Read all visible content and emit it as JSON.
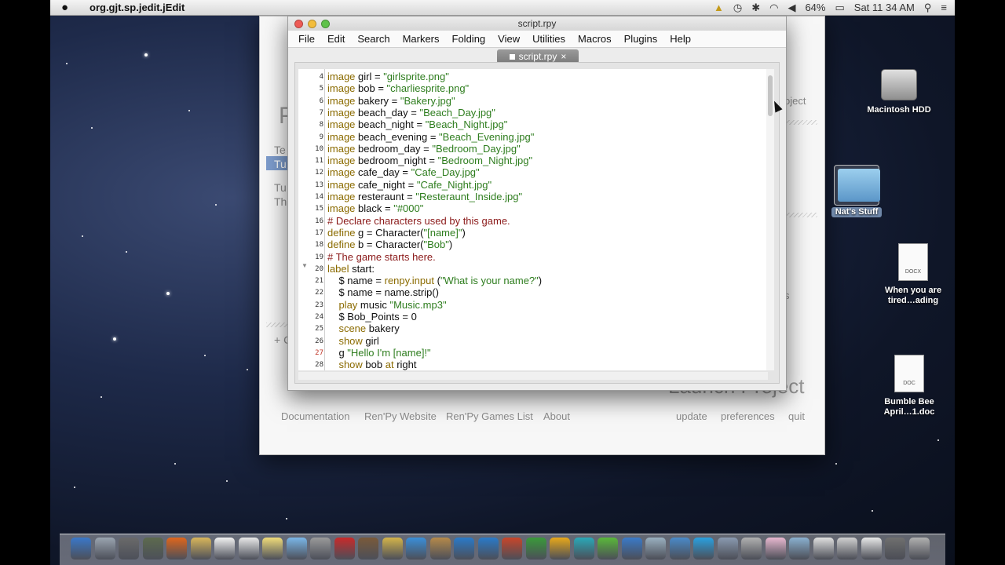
{
  "menubar": {
    "app_name": "org.gjt.sp.jedit.jEdit",
    "battery": "64%",
    "clock": "Sat 11 34 AM"
  },
  "launcher": {
    "partial_labels": [
      "Te",
      "Tu",
      "Tu",
      "Th"
    ],
    "project_partial": "oject",
    "plus_partial": "+ C",
    "launch_project": "Launch Project",
    "links": [
      "Documentation",
      "Ren'Py Website",
      "Ren'Py Games List",
      "About"
    ],
    "right_links": [
      "update",
      "preferences",
      "quit"
    ]
  },
  "editor": {
    "window_title": "script.rpy",
    "menus": [
      "File",
      "Edit",
      "Search",
      "Markers",
      "Folding",
      "View",
      "Utilities",
      "Macros",
      "Plugins",
      "Help"
    ],
    "tab_label": "script.rpy",
    "tab_close": "×",
    "lines": [
      {
        "n": "4",
        "t": [
          [
            "kw",
            "image"
          ],
          [
            "",
            "girl = "
          ],
          [
            "str",
            "\"girlsprite.png\""
          ]
        ]
      },
      {
        "n": "5",
        "t": [
          [
            "kw",
            "image"
          ],
          [
            "",
            "bob = "
          ],
          [
            "str",
            "\"charliesprite.png\""
          ]
        ]
      },
      {
        "n": "6",
        "t": [
          [
            "kw",
            "image"
          ],
          [
            "",
            "bakery = "
          ],
          [
            "str",
            "\"Bakery.jpg\""
          ]
        ]
      },
      {
        "n": "7",
        "t": [
          [
            "kw",
            "image"
          ],
          [
            "",
            "beach_day = "
          ],
          [
            "str",
            "\"Beach_Day.jpg\""
          ]
        ]
      },
      {
        "n": "8",
        "t": [
          [
            "kw",
            "image"
          ],
          [
            "",
            "beach_night = "
          ],
          [
            "str",
            "\"Beach_Night.jpg\""
          ]
        ]
      },
      {
        "n": "9",
        "t": [
          [
            "kw",
            "image"
          ],
          [
            "",
            "beach_evening = "
          ],
          [
            "str",
            "\"Beach_Evening.jpg\""
          ]
        ]
      },
      {
        "n": "10",
        "t": [
          [
            "kw",
            "image"
          ],
          [
            "",
            "bedroom_day = "
          ],
          [
            "str",
            "\"Bedroom_Day.jpg\""
          ]
        ]
      },
      {
        "n": "11",
        "t": [
          [
            "kw",
            "image"
          ],
          [
            "",
            "bedroom_night = "
          ],
          [
            "str",
            "\"Bedroom_Night.jpg\""
          ]
        ]
      },
      {
        "n": "12",
        "t": [
          [
            "kw",
            "image"
          ],
          [
            "",
            "cafe_day = "
          ],
          [
            "str",
            "\"Cafe_Day.jpg\""
          ]
        ]
      },
      {
        "n": "13",
        "t": [
          [
            "kw",
            "image"
          ],
          [
            "",
            "cafe_night = "
          ],
          [
            "str",
            "\"Cafe_Night.jpg\""
          ]
        ]
      },
      {
        "n": "14",
        "t": [
          [
            "kw",
            "image"
          ],
          [
            "",
            "resteraunt = "
          ],
          [
            "str",
            "\"Resteraunt_Inside.jpg\""
          ]
        ]
      },
      {
        "n": "15",
        "t": [
          [
            "kw",
            "image"
          ],
          [
            "",
            "black = "
          ],
          [
            "str",
            "\"#000\""
          ]
        ]
      },
      {
        "n": "16",
        "t": [
          [
            "cm",
            "# Declare characters used by this game."
          ]
        ]
      },
      {
        "n": "17",
        "t": [
          [
            "kw",
            "define"
          ],
          [
            "",
            "g = Character("
          ],
          [
            "str",
            "\"[name]\""
          ],
          [
            "",
            ")"
          ]
        ]
      },
      {
        "n": "18",
        "t": [
          [
            "kw",
            "define"
          ],
          [
            "",
            "b = Character("
          ],
          [
            "str",
            "\"Bob\""
          ],
          [
            "",
            ")"
          ]
        ]
      },
      {
        "n": "19",
        "t": [
          [
            "cm",
            "# The game starts here."
          ]
        ]
      },
      {
        "n": "20",
        "t": [
          [
            "kw",
            "label"
          ],
          [
            "",
            "start:"
          ]
        ]
      },
      {
        "n": "21",
        "t": [
          [
            "",
            "    $ name = "
          ],
          [
            "kw",
            "renpy.input"
          ],
          [
            "",
            "("
          ],
          [
            "str",
            "\"What is your name?\""
          ],
          [
            "",
            ")"
          ]
        ]
      },
      {
        "n": "22",
        "t": [
          [
            "",
            "    $ name = name.strip()"
          ]
        ]
      },
      {
        "n": "23",
        "t": [
          [
            "",
            "    "
          ],
          [
            "kw",
            "play"
          ],
          [
            "",
            "music "
          ],
          [
            "str",
            "\"Music.mp3\""
          ]
        ]
      },
      {
        "n": "24",
        "t": [
          [
            "",
            "    $ Bob_Points = 0"
          ]
        ]
      },
      {
        "n": "25",
        "t": [
          [
            "",
            "    "
          ],
          [
            "kw",
            "scene"
          ],
          [
            "",
            "bakery"
          ]
        ]
      },
      {
        "n": "26",
        "t": [
          [
            "",
            "    "
          ],
          [
            "kw",
            "show"
          ],
          [
            "",
            "girl"
          ]
        ]
      },
      {
        "n": "27",
        "t": [
          [
            "",
            "    g "
          ],
          [
            "str",
            "\"Hello I'm [name]!\""
          ]
        ]
      },
      {
        "n": "28",
        "t": [
          [
            "",
            "    "
          ],
          [
            "kw",
            "show"
          ],
          [
            "",
            "bob "
          ],
          [
            "kw",
            "at"
          ],
          [
            "",
            "right"
          ]
        ]
      }
    ]
  },
  "desktop_icons": {
    "hdd": "Macintosh HDD",
    "folder": "Nat's Stuff",
    "doc1_badge": "DOCX",
    "doc1": "When you are tired…ading",
    "doc2_badge": "DOC",
    "doc2": "Bumble Bee April…1.doc"
  },
  "dock_colors": [
    "#3a78c9",
    "#9aa4b0",
    "#6a6a6a",
    "#5d6b4e",
    "#e0661c",
    "#d9b65b",
    "#f2f2f2",
    "#e8e8e8",
    "#f0dc7a",
    "#7ab6e8",
    "#9a9a9a",
    "#c92a2a",
    "#7a5a3a",
    "#d4b44a",
    "#3a8fd9",
    "#b58a4a",
    "#2a7ac9",
    "#2a7ac9",
    "#c9452a",
    "#3a9a3a",
    "#e8a81a",
    "#2aa8b8",
    "#5ab83a",
    "#3a7ac9",
    "#9ab0c0",
    "#4a8ac9",
    "#2aa0e0",
    "#8a9ab0",
    "#b0b0b0",
    "#e8b8d0",
    "#8ab0d0",
    "#e0e0e0",
    "#d0d0d0",
    "#e8e8e8",
    "#707070",
    "#b0b0b0"
  ]
}
